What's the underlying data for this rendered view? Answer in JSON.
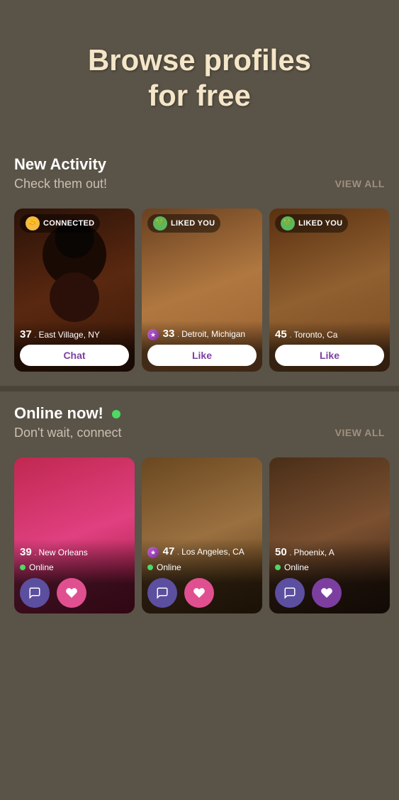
{
  "hero": {
    "title_line1": "Browse profiles",
    "title_line2": "for free"
  },
  "new_activity": {
    "section_title": "New Activity",
    "section_subtitle": "Check them out!",
    "view_all": "VIEW ALL",
    "cards": [
      {
        "id": 1,
        "status_type": "CONNECTED",
        "age": "37",
        "location": "East Village, NY",
        "btn_label": "Chat",
        "has_star": false,
        "bg_color": "#3d2020",
        "skin_color": "#2a1a0a"
      },
      {
        "id": 2,
        "status_type": "LIKED YOU",
        "age": "33",
        "location": "Detroit, Michigan",
        "btn_label": "Like",
        "has_star": true,
        "bg_color": "#4a3820",
        "skin_color": "#3a2810"
      },
      {
        "id": 3,
        "status_type": "LIKED YOU",
        "age": "45",
        "location": "Toronto, Ca",
        "btn_label": "Like",
        "has_star": false,
        "bg_color": "#3a2818",
        "skin_color": "#5a3820"
      }
    ]
  },
  "online_now": {
    "section_title": "Online now!",
    "section_subtitle": "Don't wait, connect",
    "view_all": "VIEW ALL",
    "cards": [
      {
        "id": 1,
        "age": "39",
        "location": "New Orleans",
        "online_label": "Online",
        "has_star": false,
        "bg_color": "#c03060"
      },
      {
        "id": 2,
        "age": "47",
        "location": "Los Angeles, CA",
        "online_label": "Online",
        "has_star": true,
        "bg_color": "#7a5a3a"
      },
      {
        "id": 3,
        "age": "50",
        "location": "Phoenix, A",
        "online_label": "Online",
        "has_star": false,
        "bg_color": "#5a3828"
      }
    ]
  },
  "icons": {
    "connected": "🤝",
    "liked": "💚",
    "star": "★",
    "chat": "💬",
    "heart": "♥"
  }
}
